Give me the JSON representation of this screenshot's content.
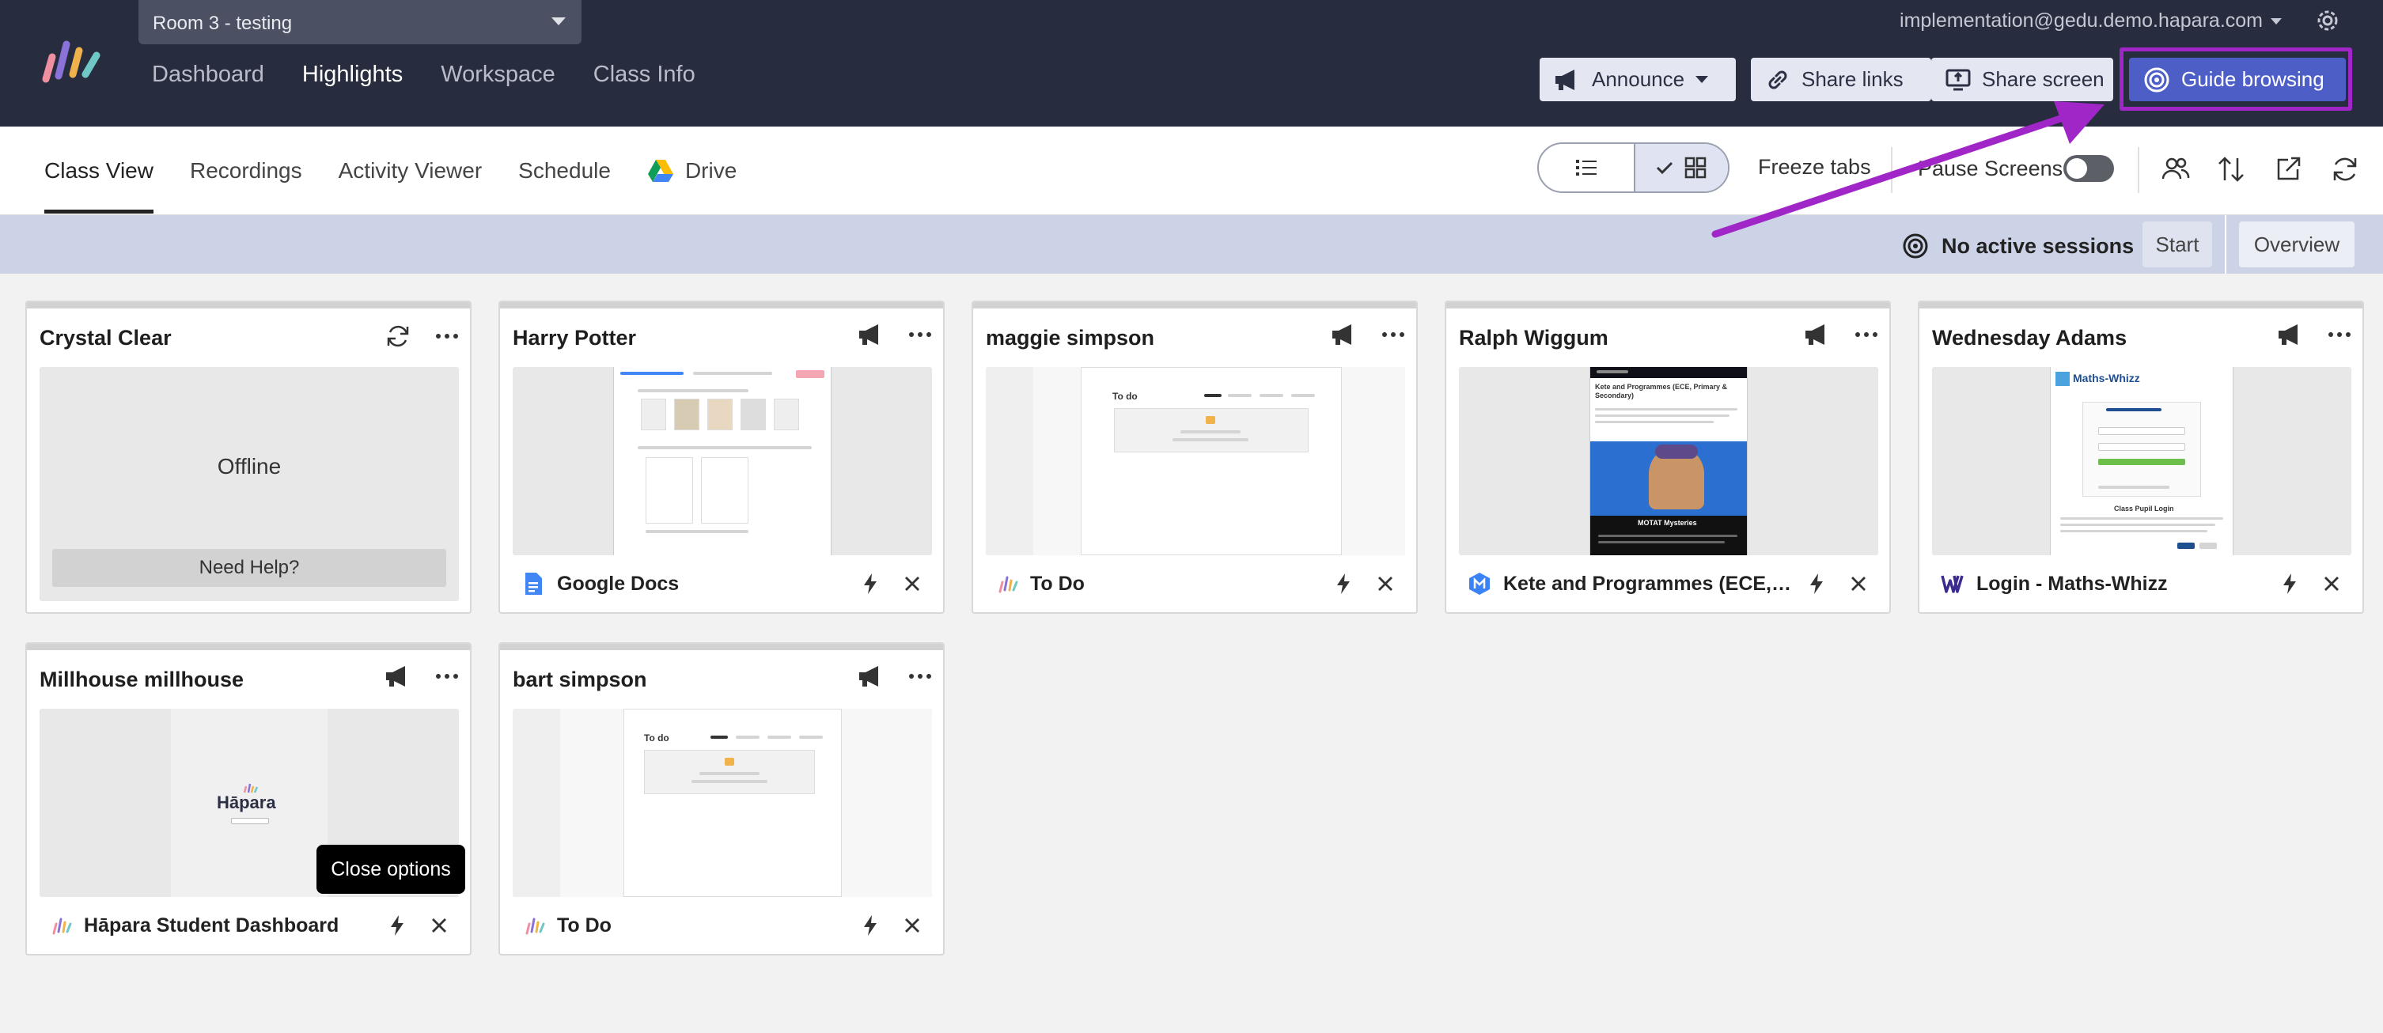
{
  "header": {
    "class_selector": "Room 3 - testing",
    "nav": [
      "Dashboard",
      "Highlights",
      "Workspace",
      "Class Info"
    ],
    "active_nav": "Highlights",
    "account_email": "implementation@gedu.demo.hapara.com",
    "buttons": {
      "announce": "Announce",
      "share_links": "Share links",
      "share_screen": "Share screen",
      "guide_browsing": "Guide browsing"
    }
  },
  "subnav": {
    "tabs": [
      "Class View",
      "Recordings",
      "Activity Viewer",
      "Schedule",
      "Drive"
    ],
    "active_tab": "Class View",
    "freeze_tabs": "Freeze tabs",
    "pause_screens": "Pause Screens"
  },
  "session": {
    "status": "No active sessions",
    "start": "Start",
    "overview": "Overview"
  },
  "students": [
    {
      "name": "Crystal Clear",
      "status": "Offline",
      "help": "Need Help?"
    },
    {
      "name": "Harry Potter",
      "tab_title": "Google Docs",
      "favicon": "google-docs-icon"
    },
    {
      "name": "maggie simpson",
      "tab_title": "To Do",
      "favicon": "hapara-icon"
    },
    {
      "name": "Ralph Wiggum",
      "tab_title": "Kete and Programmes (ECE, Primary & Secondary)",
      "favicon": "kete-icon",
      "thumb_heading": "Kete and Programmes (ECE, Primary & Secondary)",
      "thumb_caption": "MOTAT Mysteries"
    },
    {
      "name": "Wednesday Adams",
      "tab_title": "Login - Maths-Whizz",
      "favicon": "maths-whizz-icon",
      "thumb_logo": "Maths-Whizz",
      "thumb_heading": "Class Pupil Login"
    },
    {
      "name": "Millhouse millhouse",
      "tab_title": "Hāpara Student Dashboard",
      "favicon": "hapara-icon",
      "thumb_logo": "Hāpara"
    },
    {
      "name": "bart simpson",
      "tab_title": "To Do",
      "favicon": "hapara-icon"
    }
  ],
  "thumb_todo_title": "To do",
  "tooltip": "Close options",
  "colors": {
    "header_bg": "#272d3f",
    "accent": "#4d5fc7",
    "annotation": "#a126c8",
    "session_bar": "#cdd3e7"
  }
}
